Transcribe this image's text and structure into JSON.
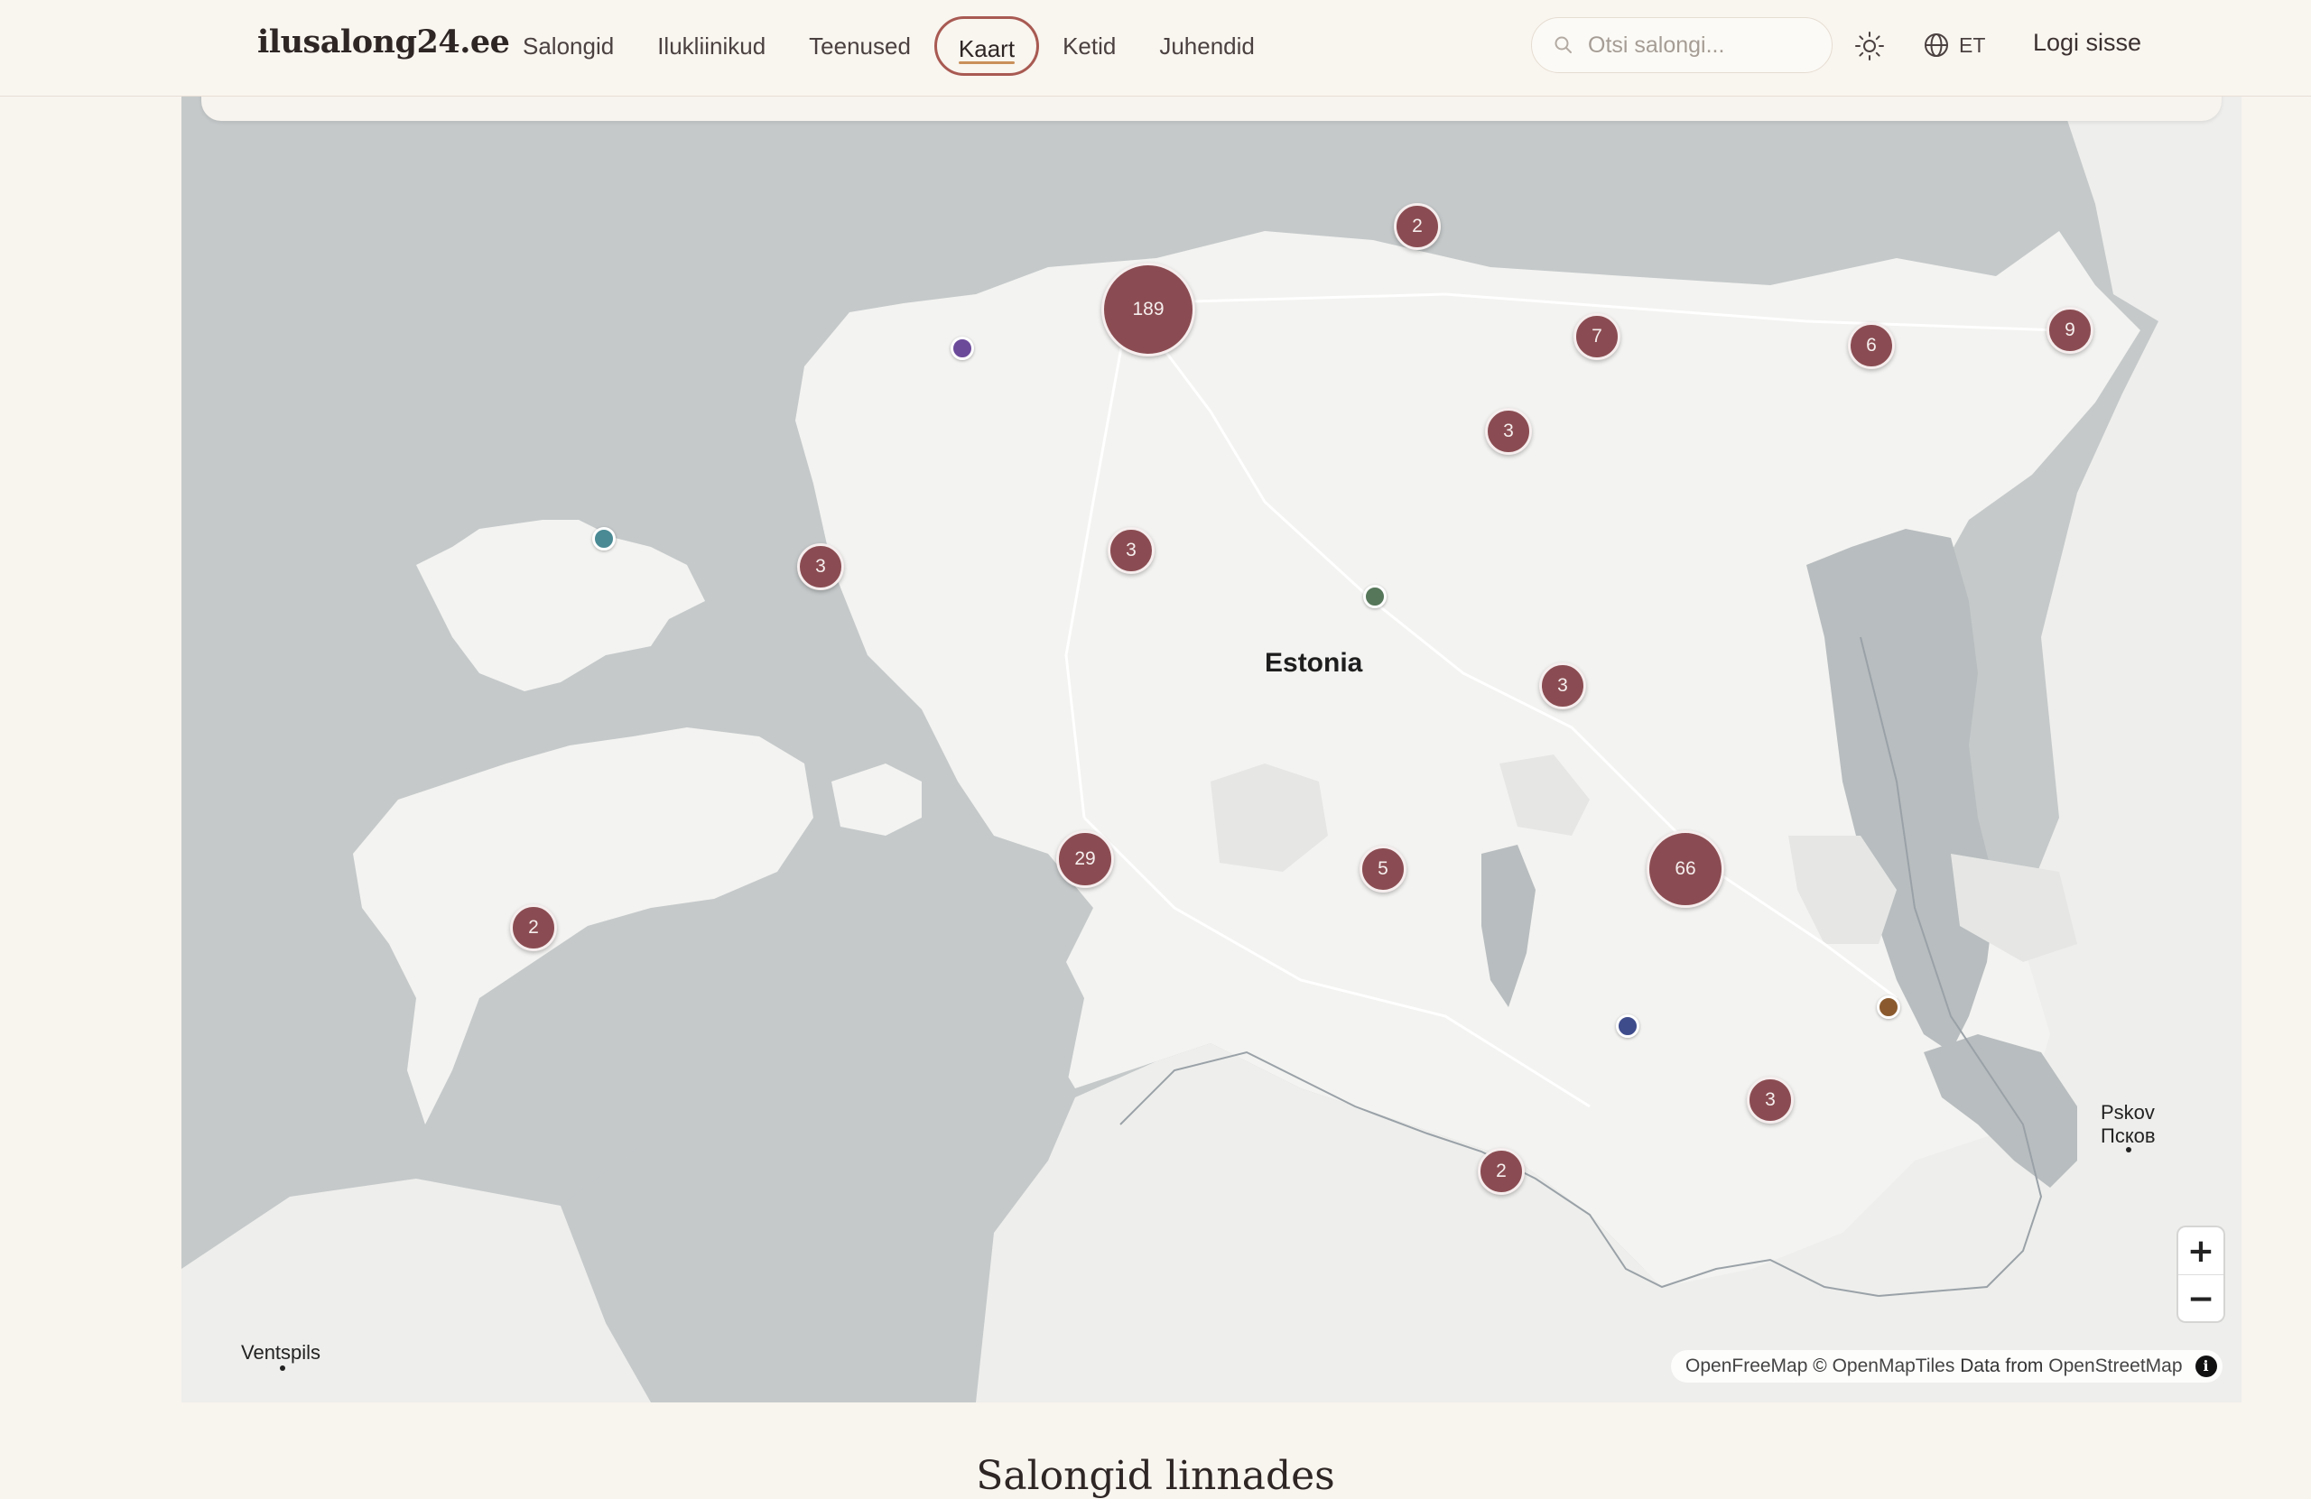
{
  "header": {
    "logo": "ilusalong24.ee",
    "nav": [
      {
        "label": "Salongid",
        "active": false
      },
      {
        "label": "Ilukliinikud",
        "active": false
      },
      {
        "label": "Teenused",
        "active": false
      },
      {
        "label": "Kaart",
        "active": true
      },
      {
        "label": "Ketid",
        "active": false
      },
      {
        "label": "Juhendid",
        "active": false
      }
    ],
    "search_placeholder": "Otsi salongi...",
    "language": "ET",
    "login": "Logi sisse"
  },
  "map": {
    "country_label": "Estonia",
    "city_labels": {
      "pskov_latin": "Pskov",
      "pskov_cyrillic": "Псков",
      "ventspils": "Ventspils"
    },
    "clusters": [
      "189",
      "2",
      "7",
      "6",
      "9",
      "3",
      "3",
      "3",
      "3",
      "29",
      "5",
      "66",
      "2",
      "3",
      "2"
    ],
    "pin_colors": [
      "#6c4a9a",
      "#4a8a94",
      "#56775a",
      "#3f4c8c",
      "#8a5a2e"
    ],
    "cluster_color": "#8a4c52",
    "zoom_in": "+",
    "zoom_out": "−",
    "attribution": {
      "openfreemap": "OpenFreeMap",
      "copyright": "©",
      "openmaptiles": "OpenMapTiles",
      "data_from": "Data from",
      "openstreetmap": "OpenStreetMap"
    }
  },
  "section_title": "Salongid linnades"
}
